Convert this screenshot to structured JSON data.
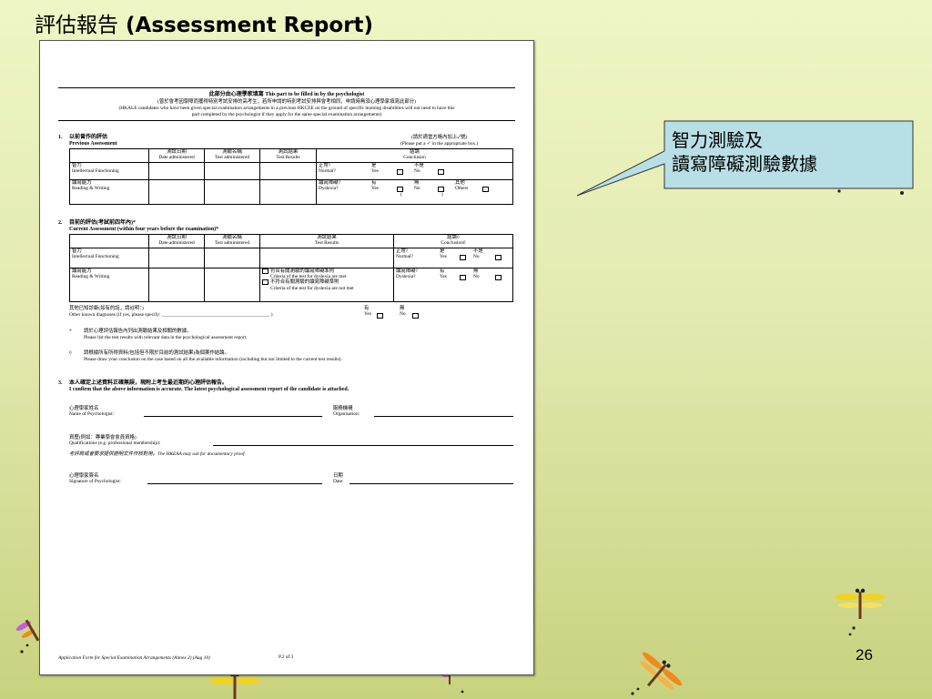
{
  "slide": {
    "title_cjk": "評估報告",
    "title_en": "(Assessment Report)",
    "page_number": "26"
  },
  "callout": {
    "line1": "智力測驗及",
    "line2": "讀寫障礙測驗數據"
  },
  "doc": {
    "header": {
      "line1": "此部分由心理學家填寫 This part to be filled in by the psychologist",
      "line2": "(曾於會考因學障而獲得特別考試安排的高考生，若所申請的特別考試安排與會考相同，申請時無須心理學家填寫此部分)",
      "line3": "(HKALE candidates who have been given special examination arrangements in a previous HKCEE on the ground of specific learning disabilities will not need to have this",
      "line4": "part completed by the psychologist if they apply for the same special examination arrangements)"
    },
    "s1": {
      "num": "1.",
      "title_cjk": "以前曾作的評估",
      "title_en": "Previous Assessment",
      "note_cjk": "(請於適當方格內加上✓號)",
      "note_en": "(Please put a ✓ in the appropriate box.)",
      "col_date": "測試日期\nDate administered",
      "col_test": "測驗名稱\nTest administered",
      "col_result": "測試結果\nTest Results",
      "col_concl": "結論\nConclusion",
      "row1": "智力\nIntellectual Functioning",
      "row1_q": "正常?\nNormal?",
      "row1_yes": "是\nYes",
      "row1_no": "不是\nNo",
      "row2": "讀寫能力\nReading & Writing",
      "row2_q": "讀寫障礙?\nDyslexia?",
      "row2_yes": "有\nYes",
      "row2_no": "無\nNo",
      "row2_other": "其他\nOthers",
      "row2_paren": "(                                )"
    },
    "s2": {
      "num": "2.",
      "title_cjk": "目前的評估(考試前四年內)*",
      "title_en": "Current Assessment (within four years before the examination)*",
      "col_date": "測試日期\nDate administered",
      "col_test": "測驗名稱\nTest administered",
      "col_result": "測試結果\nTest Results",
      "col_concl": "結論◊\nConclusion◊",
      "row1": "智力\nIntellectual Functioning",
      "row1_q": "正常?\nNormal?",
      "row1_yes": "是\nYes",
      "row1_no": "不是\nNo",
      "row2": "讀寫能力\nReading & Writing",
      "crit1": "符合有關測驗的讀寫障礙準則\nCriteria of the test for dyslexia are met",
      "crit2": "不符合有關測驗的讀寫障礙準則\nCriteria of the test for dyslexia are not met",
      "row2_q": "讀寫障礙?\nDyslexia?",
      "row2_yes": "有\nYes",
      "row2_no": "無\nNo",
      "other_cjk": "其他已知診斷(如有的話，請註明：)",
      "other_en": "Other known diagnoses (if yes, please specify: ____________________________________________ )",
      "other_yes": "有\nYes",
      "other_no": "無\nNo",
      "note1_mark": "*",
      "note1_cjk": "請於心理評估報告內列出測驗結果及相關的數據。",
      "note1_en": "Please list the test results with relevant data in the psychological assessment report.",
      "note2_mark": "◊",
      "note2_cjk": "請根據所有所得資料(包括但不限於目前的測試結果)為個案作結論。",
      "note2_en": "Please draw your conclusion on the case based on all the available information (including but not limited to the current test results)."
    },
    "s3": {
      "num": "3.",
      "confirm_cjk": "本人確定上述資料正確無誤，現附上考生最近期的心理評估報告。",
      "confirm_en": "I confirm that the above information is accurate. The latest psychological assessment report of the candidate is attached.",
      "name_label": "心理學家姓名\nName of Psychologist:",
      "org_label": "服務機構\nOrganisation:",
      "qual_label": "資歷(例如：專業學會會員資格)\nQualifications (e.g. professional membership):",
      "qual_note": "考評局或會要求提供證明文件作核對用。The HKEAA may ask for documentary proof.",
      "sig_label": "心理學家簽名\nSignature of Psychologist:",
      "date_label": "日期\nDate:"
    },
    "footer": {
      "form_name": "Application Form for Special Examination Arrangements (Annex 2) (Aug 10)",
      "page": "P.2 of 3"
    }
  },
  "colors": {
    "callout_fill": "#b9dfe6",
    "background_top": "#eef6c4",
    "background_bottom": "#c8d27e"
  },
  "icons": [
    "dragonfly-icon"
  ]
}
